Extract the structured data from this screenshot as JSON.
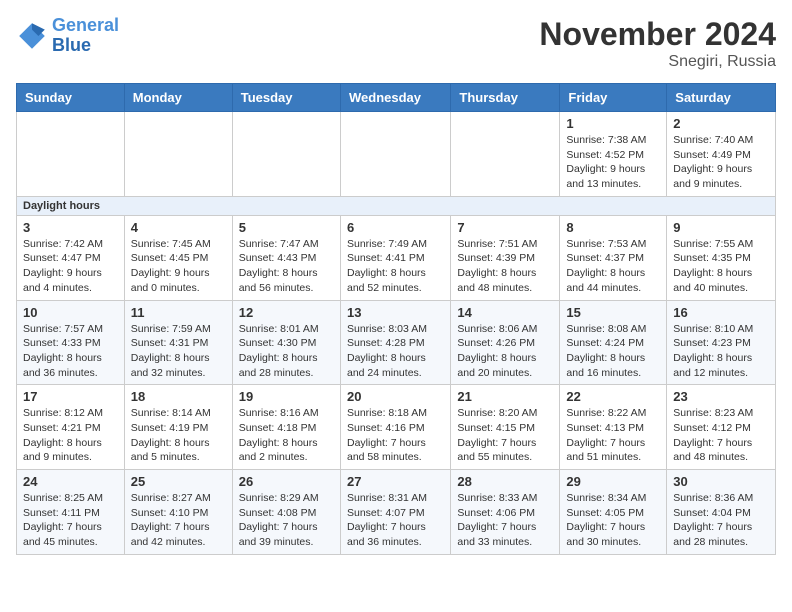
{
  "logo": {
    "line1": "General",
    "line2": "Blue"
  },
  "title": "November 2024",
  "location": "Snegiri, Russia",
  "days_of_week": [
    "Sunday",
    "Monday",
    "Tuesday",
    "Wednesday",
    "Thursday",
    "Friday",
    "Saturday"
  ],
  "weeks": [
    {
      "cells": [
        {
          "day": null,
          "info": null
        },
        {
          "day": null,
          "info": null
        },
        {
          "day": null,
          "info": null
        },
        {
          "day": null,
          "info": null
        },
        {
          "day": null,
          "info": null
        },
        {
          "day": "1",
          "info": "Sunrise: 7:38 AM\nSunset: 4:52 PM\nDaylight: 9 hours and 13 minutes."
        },
        {
          "day": "2",
          "info": "Sunrise: 7:40 AM\nSunset: 4:49 PM\nDaylight: 9 hours and 9 minutes."
        }
      ]
    },
    {
      "cells": [
        {
          "day": "3",
          "info": "Sunrise: 7:42 AM\nSunset: 4:47 PM\nDaylight: 9 hours and 4 minutes."
        },
        {
          "day": "4",
          "info": "Sunrise: 7:45 AM\nSunset: 4:45 PM\nDaylight: 9 hours and 0 minutes."
        },
        {
          "day": "5",
          "info": "Sunrise: 7:47 AM\nSunset: 4:43 PM\nDaylight: 8 hours and 56 minutes."
        },
        {
          "day": "6",
          "info": "Sunrise: 7:49 AM\nSunset: 4:41 PM\nDaylight: 8 hours and 52 minutes."
        },
        {
          "day": "7",
          "info": "Sunrise: 7:51 AM\nSunset: 4:39 PM\nDaylight: 8 hours and 48 minutes."
        },
        {
          "day": "8",
          "info": "Sunrise: 7:53 AM\nSunset: 4:37 PM\nDaylight: 8 hours and 44 minutes."
        },
        {
          "day": "9",
          "info": "Sunrise: 7:55 AM\nSunset: 4:35 PM\nDaylight: 8 hours and 40 minutes."
        }
      ]
    },
    {
      "cells": [
        {
          "day": "10",
          "info": "Sunrise: 7:57 AM\nSunset: 4:33 PM\nDaylight: 8 hours and 36 minutes."
        },
        {
          "day": "11",
          "info": "Sunrise: 7:59 AM\nSunset: 4:31 PM\nDaylight: 8 hours and 32 minutes."
        },
        {
          "day": "12",
          "info": "Sunrise: 8:01 AM\nSunset: 4:30 PM\nDaylight: 8 hours and 28 minutes."
        },
        {
          "day": "13",
          "info": "Sunrise: 8:03 AM\nSunset: 4:28 PM\nDaylight: 8 hours and 24 minutes."
        },
        {
          "day": "14",
          "info": "Sunrise: 8:06 AM\nSunset: 4:26 PM\nDaylight: 8 hours and 20 minutes."
        },
        {
          "day": "15",
          "info": "Sunrise: 8:08 AM\nSunset: 4:24 PM\nDaylight: 8 hours and 16 minutes."
        },
        {
          "day": "16",
          "info": "Sunrise: 8:10 AM\nSunset: 4:23 PM\nDaylight: 8 hours and 12 minutes."
        }
      ]
    },
    {
      "cells": [
        {
          "day": "17",
          "info": "Sunrise: 8:12 AM\nSunset: 4:21 PM\nDaylight: 8 hours and 9 minutes."
        },
        {
          "day": "18",
          "info": "Sunrise: 8:14 AM\nSunset: 4:19 PM\nDaylight: 8 hours and 5 minutes."
        },
        {
          "day": "19",
          "info": "Sunrise: 8:16 AM\nSunset: 4:18 PM\nDaylight: 8 hours and 2 minutes."
        },
        {
          "day": "20",
          "info": "Sunrise: 8:18 AM\nSunset: 4:16 PM\nDaylight: 7 hours and 58 minutes."
        },
        {
          "day": "21",
          "info": "Sunrise: 8:20 AM\nSunset: 4:15 PM\nDaylight: 7 hours and 55 minutes."
        },
        {
          "day": "22",
          "info": "Sunrise: 8:22 AM\nSunset: 4:13 PM\nDaylight: 7 hours and 51 minutes."
        },
        {
          "day": "23",
          "info": "Sunrise: 8:23 AM\nSunset: 4:12 PM\nDaylight: 7 hours and 48 minutes."
        }
      ]
    },
    {
      "cells": [
        {
          "day": "24",
          "info": "Sunrise: 8:25 AM\nSunset: 4:11 PM\nDaylight: 7 hours and 45 minutes."
        },
        {
          "day": "25",
          "info": "Sunrise: 8:27 AM\nSunset: 4:10 PM\nDaylight: 7 hours and 42 minutes."
        },
        {
          "day": "26",
          "info": "Sunrise: 8:29 AM\nSunset: 4:08 PM\nDaylight: 7 hours and 39 minutes."
        },
        {
          "day": "27",
          "info": "Sunrise: 8:31 AM\nSunset: 4:07 PM\nDaylight: 7 hours and 36 minutes."
        },
        {
          "day": "28",
          "info": "Sunrise: 8:33 AM\nSunset: 4:06 PM\nDaylight: 7 hours and 33 minutes."
        },
        {
          "day": "29",
          "info": "Sunrise: 8:34 AM\nSunset: 4:05 PM\nDaylight: 7 hours and 30 minutes."
        },
        {
          "day": "30",
          "info": "Sunrise: 8:36 AM\nSunset: 4:04 PM\nDaylight: 7 hours and 28 minutes."
        }
      ]
    }
  ],
  "daylight_label": "Daylight hours"
}
